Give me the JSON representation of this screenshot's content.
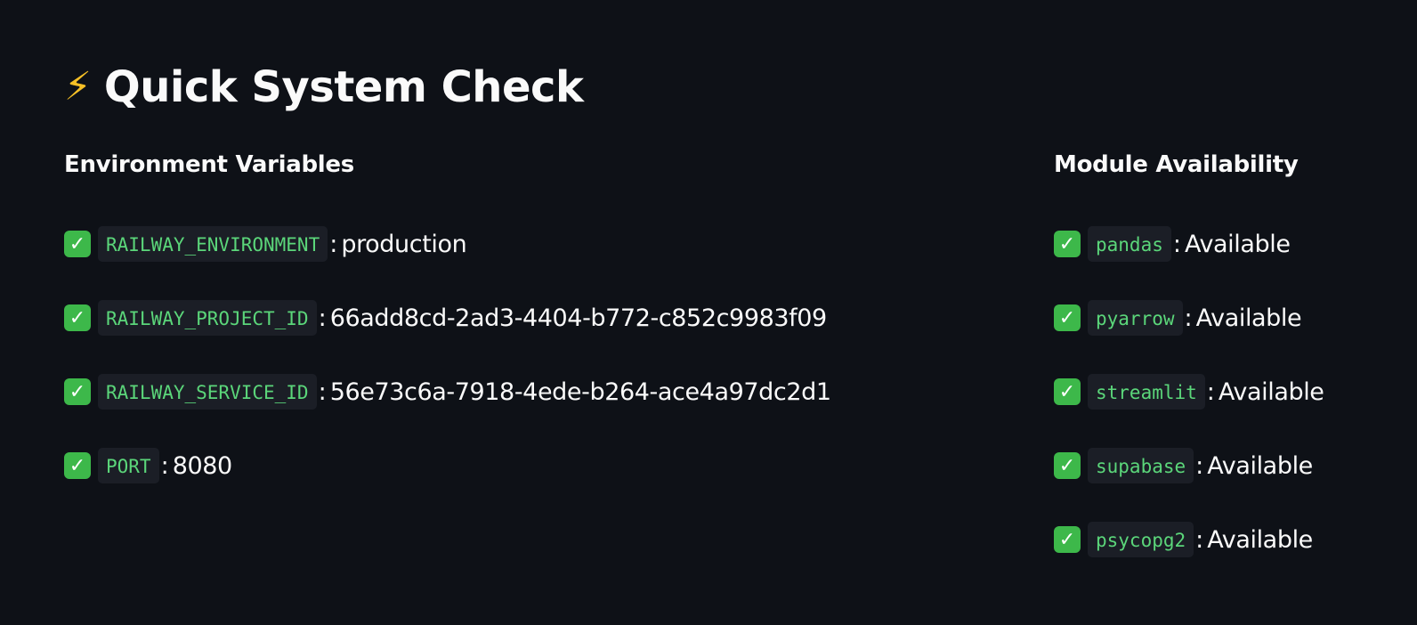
{
  "page": {
    "title_icon": "⚡",
    "title": "Quick System Check"
  },
  "env": {
    "heading": "Environment Variables",
    "items": [
      {
        "status_icon": "check-mark-icon",
        "name": "RAILWAY_ENVIRONMENT",
        "separator": ":",
        "value": "production"
      },
      {
        "status_icon": "check-mark-icon",
        "name": "RAILWAY_PROJECT_ID",
        "separator": ":",
        "value": "66add8cd-2ad3-4404-b772-c852c9983f09"
      },
      {
        "status_icon": "check-mark-icon",
        "name": "RAILWAY_SERVICE_ID",
        "separator": ":",
        "value": "56e73c6a-7918-4ede-b264-ace4a97dc2d1"
      },
      {
        "status_icon": "check-mark-icon",
        "name": "PORT",
        "separator": ":",
        "value": "8080"
      }
    ]
  },
  "modules": {
    "heading": "Module Availability",
    "items": [
      {
        "status_icon": "check-mark-icon",
        "name": "pandas",
        "separator": ":",
        "value": "Available"
      },
      {
        "status_icon": "check-mark-icon",
        "name": "pyarrow",
        "separator": ":",
        "value": "Available"
      },
      {
        "status_icon": "check-mark-icon",
        "name": "streamlit",
        "separator": ":",
        "value": "Available"
      },
      {
        "status_icon": "check-mark-icon",
        "name": "supabase",
        "separator": ":",
        "value": "Available"
      },
      {
        "status_icon": "check-mark-icon",
        "name": "psycopg2",
        "separator": ":",
        "value": "Available"
      }
    ]
  },
  "colors": {
    "background": "#0e1117",
    "text": "#fafafa",
    "code_text": "#5bd67a",
    "code_background": "#1b1e26",
    "check_badge": "#3db84a",
    "lightning": "#f6c026"
  },
  "glyphs": {
    "check": "✓"
  }
}
